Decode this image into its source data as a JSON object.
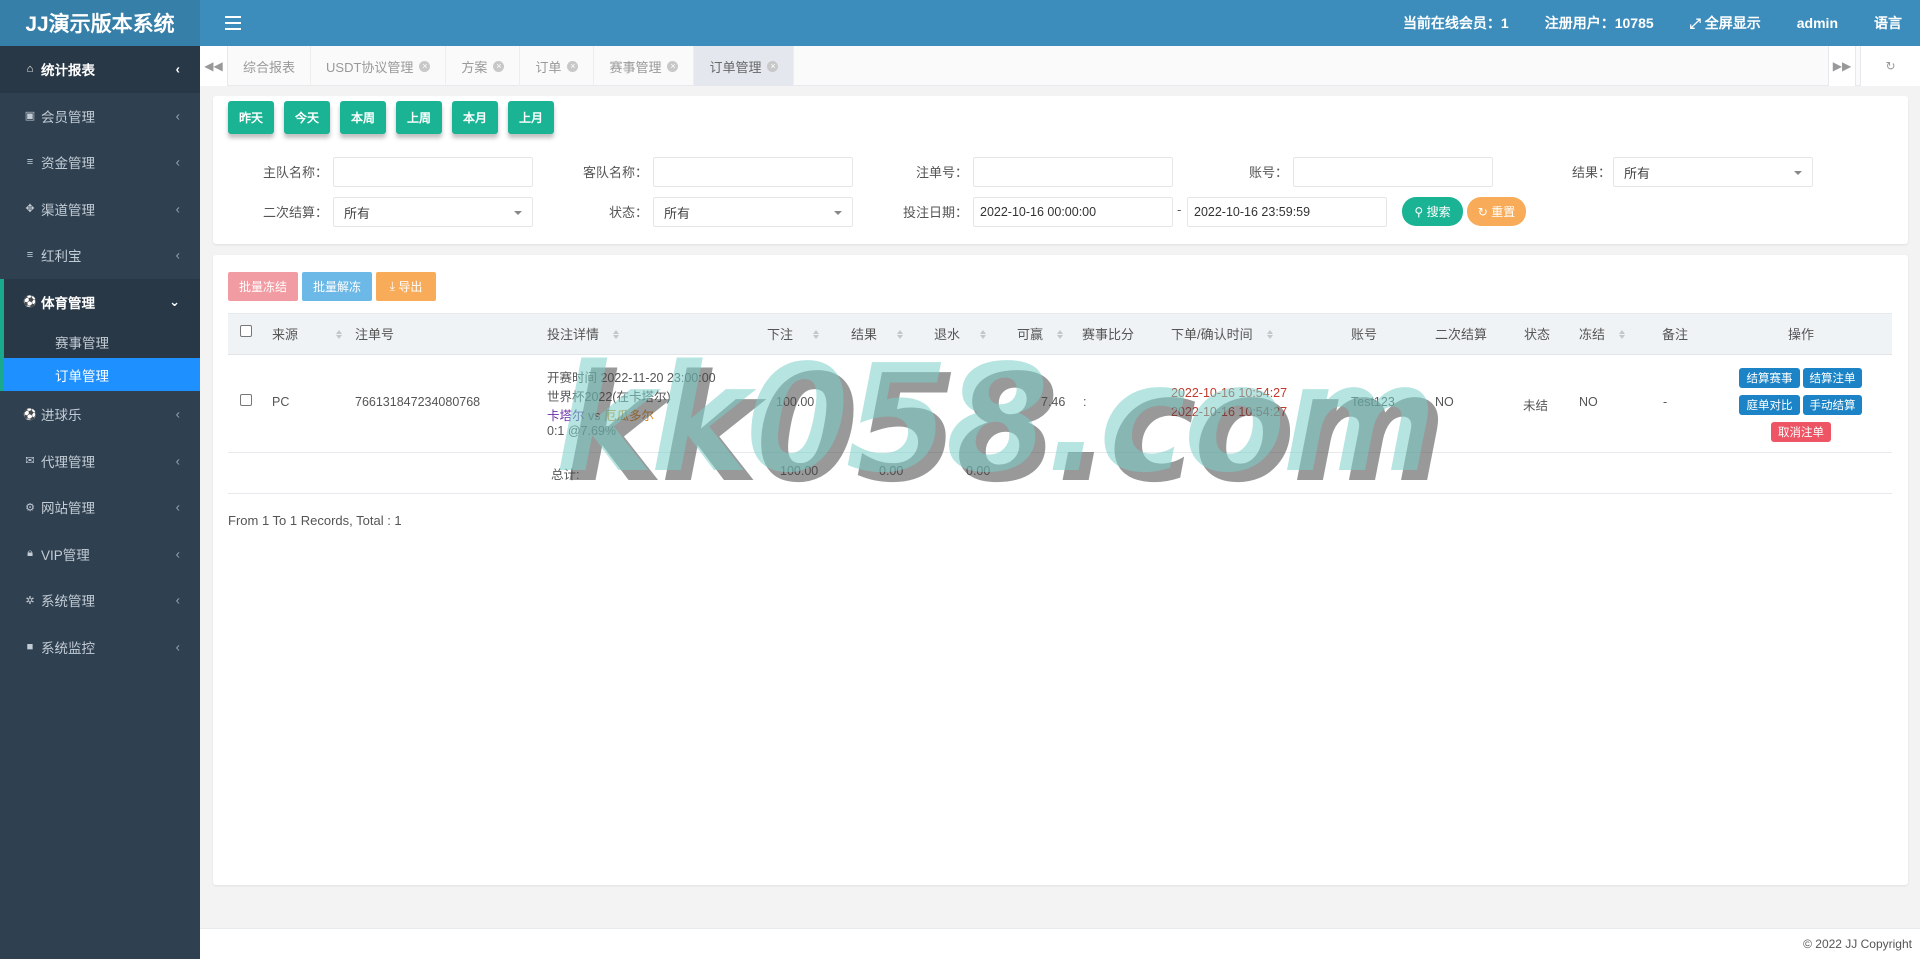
{
  "app_title": "JJ演示版本系统",
  "header": {
    "online_members": "当前在线会员：1",
    "registered_users": "注册用户：10785",
    "fullscreen": "全屏显示",
    "user": "admin",
    "language": "语言"
  },
  "sidebar": {
    "items": [
      {
        "label": "统计报表",
        "icon": "home-icon"
      },
      {
        "label": "会员管理",
        "icon": "address-card-icon"
      },
      {
        "label": "资金管理",
        "icon": "database-icon"
      },
      {
        "label": "渠道管理",
        "icon": "paw-icon"
      },
      {
        "label": "红利宝",
        "icon": "database-icon"
      },
      {
        "label": "体育管理",
        "icon": "soccer-ball-icon"
      },
      {
        "label": "进球乐",
        "icon": "soccer-ball-icon"
      },
      {
        "label": "代理管理",
        "icon": "envelope-icon"
      },
      {
        "label": "网站管理",
        "icon": "cogs-icon"
      },
      {
        "label": "VIP管理",
        "icon": "lock-icon"
      },
      {
        "label": "系统管理",
        "icon": "gear-icon"
      },
      {
        "label": "系统监控",
        "icon": "video-icon"
      }
    ],
    "sub_items": [
      "赛事管理",
      "订单管理"
    ]
  },
  "tabs": [
    "综合报表",
    "USDT协议管理",
    "方案",
    "订单",
    "赛事管理",
    "订单管理"
  ],
  "quick_dates": [
    "昨天",
    "今天",
    "本周",
    "上周",
    "本月",
    "上月"
  ],
  "filters": {
    "home_team_label": "主队名称：",
    "away_team_label": "客队名称：",
    "order_no_label": "注单号：",
    "account_label": "账号：",
    "result_label": "结果：",
    "result_value": "所有",
    "second_settle_label": "二次结算：",
    "second_settle_value": "所有",
    "status_label": "状态：",
    "status_value": "所有",
    "bet_date_label": "投注日期：",
    "date_from": "2022-10-16 00:00:00",
    "date_sep": "-",
    "date_to": "2022-10-16 23:59:59",
    "search": "搜索",
    "reset": "重置"
  },
  "actions": {
    "batch_freeze": "批量冻结",
    "batch_unfreeze": "批量解冻",
    "export": "导出"
  },
  "table": {
    "headers": [
      "来源",
      "注单号",
      "投注详情",
      "下注",
      "结果",
      "退水",
      "可赢",
      "赛事比分",
      "下单/确认时间",
      "账号",
      "二次结算",
      "状态",
      "冻结",
      "备注",
      "操作"
    ],
    "rows": [
      {
        "source": "PC",
        "order_no": "766131847234080768",
        "detail_time": "开赛时间 2022-11-20 23:00:00",
        "detail_league": "世界杯2022(在卡塔尔)",
        "team_home": "卡塔尔",
        "vs": "vs",
        "team_away": "厄瓜多尔",
        "odds": "0:1 @7.69%",
        "bet": "100.00",
        "result": "",
        "rebate": "",
        "win": "7.46",
        "score": ":",
        "order_time": "2022-10-16 10:54:27",
        "confirm_time": "2022-10-16 10:54:27",
        "account": "Test123",
        "second_settle": "NO",
        "status": "未结",
        "frozen": "NO",
        "remark": "-",
        "ops": [
          "结算赛事",
          "结算注单",
          "庭单对比",
          "手动结算",
          "取消注单"
        ]
      }
    ],
    "total_label": "总计:",
    "total_bet": "100.00",
    "total_result": "0.00",
    "total_rebate": "0.00"
  },
  "pagination": "From 1 To 1 Records, Total : 1",
  "watermark": "kk058.com",
  "footer": "© 2022 JJ Copyright",
  "colors": {
    "header": "#3c8dbc",
    "sidebar": "#2f4050",
    "primary": "#1ab394",
    "active_tab": "#1e90ff"
  }
}
